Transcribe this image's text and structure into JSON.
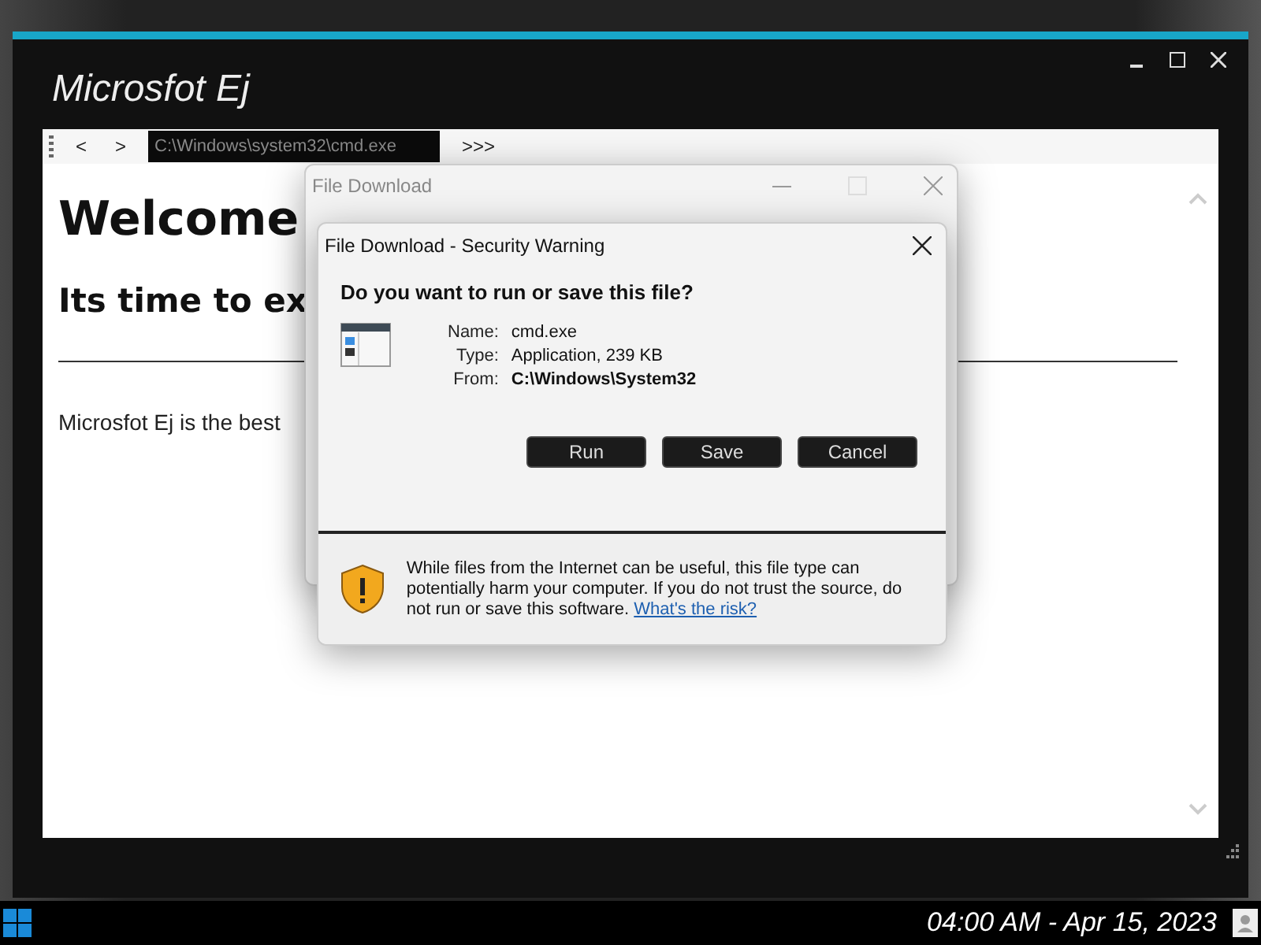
{
  "window": {
    "title": "Microsfot Ej"
  },
  "toolbar": {
    "back": "<",
    "forward": ">",
    "address": "C:\\Windows\\system32\\cmd.exe",
    "more": ">>>"
  },
  "page": {
    "heading": "Welcome",
    "subheading": "Its time to ex",
    "paragraph": "Microsfot Ej is the best"
  },
  "back_dialog": {
    "title": "File Download"
  },
  "dialog": {
    "title": "File Download - Security Warning",
    "question": "Do you want to run or save this file?",
    "fields": [
      {
        "label": "Name:",
        "value": "cmd.exe",
        "bold": false
      },
      {
        "label": "Type:",
        "value": "Application, 239 KB",
        "bold": false
      },
      {
        "label": "From:",
        "value": "C:\\Windows\\System32",
        "bold": true
      }
    ],
    "buttons": [
      "Run",
      "Save",
      "Cancel"
    ],
    "warning": "While files from the Internet can be useful, this file type can potentially harm your computer. If you do not trust the source, do not run or save this software.",
    "link": "What's the risk?"
  },
  "taskbar": {
    "clock": "04:00 AM - Apr 15, 2023"
  }
}
